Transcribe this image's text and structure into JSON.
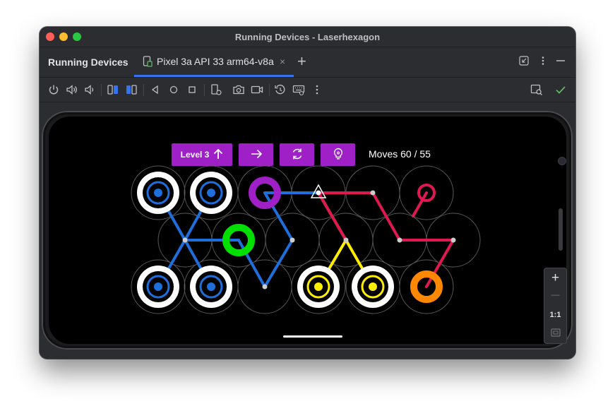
{
  "window": {
    "title": "Running Devices - Laserhexagon"
  },
  "panel": {
    "title": "Running Devices"
  },
  "tab": {
    "label": "Pixel 3a API 33 arm64-v8a",
    "close": "×",
    "add": "+"
  },
  "game": {
    "level_label": "Level 3",
    "moves_label": "Moves 60 / 55",
    "button_color": "#a020c8"
  },
  "zoom": {
    "plus": "+",
    "minus": "—",
    "ratio": "1:1"
  },
  "colors": {
    "blue": "#1e6fdc",
    "green": "#00e000",
    "magenta": "#a020c8",
    "yellow": "#ffee00",
    "pink": "#e01850",
    "orange": "#ff8800",
    "accent": "#3574f0"
  }
}
